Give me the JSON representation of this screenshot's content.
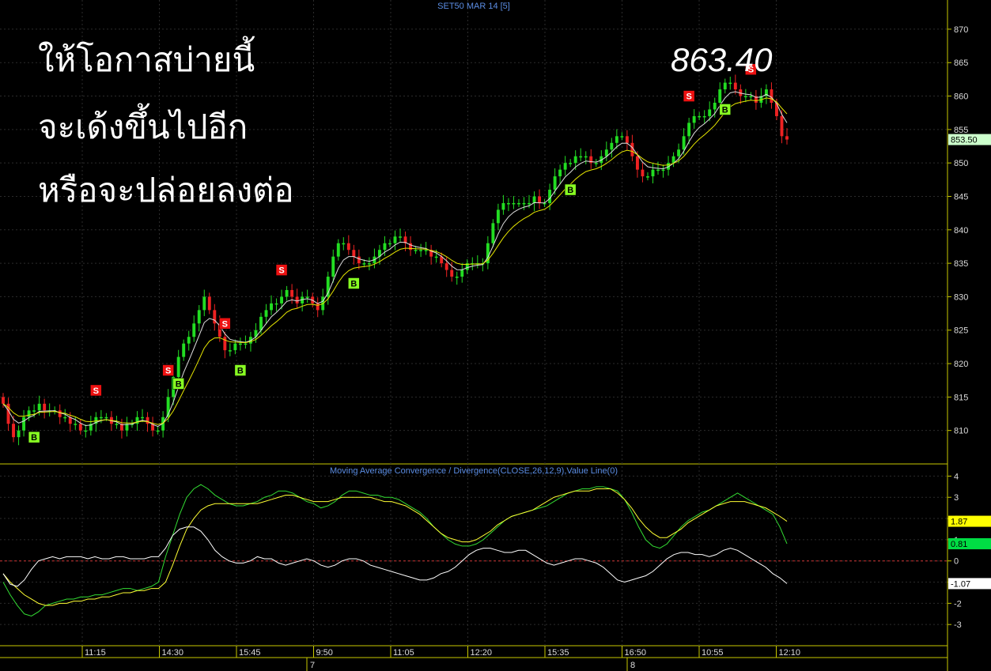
{
  "header": {
    "title": "SET50 MAR 14   [5]"
  },
  "annotations": {
    "line1": "ให้โอกาสบ่ายนี้",
    "line2": "จะเด้งขึ้นไปอีก",
    "line3": "หรือจะปล่อยลงต่อ",
    "price_note": "863.40"
  },
  "indicator": {
    "title": "Moving Average Convergence / Divergence(CLOSE,26,12,9),Value Line(0)"
  },
  "chart_data": [
    {
      "type": "candlestick",
      "title": "SET50 MAR 14   [5]",
      "ylim": [
        805,
        872
      ],
      "yticks": [
        810,
        815,
        820,
        825,
        830,
        835,
        840,
        845,
        850,
        855,
        860,
        865,
        870
      ],
      "last_price": "853.50",
      "x_tick_labels": [
        "11:15",
        "14:30",
        "15:45",
        "9:50",
        "11:05",
        "12:20",
        "15:35",
        "16:50",
        "10:55",
        "12:10"
      ],
      "day_labels": [
        "7",
        "8"
      ],
      "closes": [
        814,
        811,
        809,
        810,
        812,
        813,
        813,
        814,
        813,
        813,
        813,
        812,
        812,
        811,
        811,
        810,
        810,
        811,
        812,
        812,
        812,
        811,
        811,
        810,
        811,
        811,
        812,
        812,
        811,
        810,
        810,
        812,
        815,
        818,
        821,
        823,
        824,
        826,
        828,
        830,
        828,
        826,
        824,
        822,
        822,
        823,
        823,
        823,
        824,
        825,
        827,
        828,
        829,
        829,
        830,
        831,
        830,
        829,
        830,
        830,
        829,
        828,
        830,
        833,
        836,
        838,
        838,
        837,
        836,
        835,
        835,
        835,
        836,
        837,
        838,
        838,
        839,
        839,
        838,
        837,
        837,
        837,
        837,
        836,
        836,
        835,
        834,
        833,
        833,
        834,
        835,
        835,
        835,
        835,
        838,
        841,
        843,
        844,
        844,
        844,
        844,
        844,
        844,
        845,
        844,
        844,
        846,
        848,
        849,
        850,
        850,
        851,
        851,
        851,
        850,
        850,
        851,
        852,
        853,
        854,
        854,
        853,
        851,
        849,
        848,
        848,
        849,
        849,
        849,
        850,
        851,
        852,
        854,
        856,
        857,
        857,
        857,
        858,
        859,
        861,
        862,
        862,
        861,
        860,
        860,
        860,
        859,
        860,
        861,
        859,
        857,
        854,
        853.5
      ],
      "signals": [
        {
          "label": "B",
          "i": 6
        },
        {
          "label": "S",
          "i": 18
        },
        {
          "label": "S",
          "i": 32
        },
        {
          "label": "B",
          "i": 34
        },
        {
          "label": "S",
          "i": 43
        },
        {
          "label": "B",
          "i": 46
        },
        {
          "label": "S",
          "i": 54
        },
        {
          "label": "B",
          "i": 68
        },
        {
          "label": "B",
          "i": 110
        },
        {
          "label": "S",
          "i": 133
        },
        {
          "label": "B",
          "i": 140
        },
        {
          "label": "S",
          "i": 145
        }
      ]
    },
    {
      "type": "line",
      "title": "Moving Average Convergence / Divergence(CLOSE,26,12,9),Value Line(0)",
      "ylim": [
        -4,
        4.5
      ],
      "yticks": [
        4,
        3,
        2,
        1,
        0,
        -1,
        -2,
        -3
      ],
      "value_line": 0,
      "badges": [
        {
          "value": "1.87",
          "color": "#ffff00",
          "text_color": "#000000"
        },
        {
          "value": "0.81",
          "color": "#00dd44",
          "text_color": "#000000"
        },
        {
          "value": "-1.07",
          "color": "#ffffff",
          "text_color": "#000000"
        }
      ],
      "series": [
        {
          "color": "#33dd33",
          "values": [
            -1.0,
            -1.6,
            -2.1,
            -2.5,
            -2.6,
            -2.4,
            -2.1,
            -2.0,
            -1.9,
            -1.8,
            -1.8,
            -1.7,
            -1.7,
            -1.6,
            -1.6,
            -1.5,
            -1.4,
            -1.3,
            -1.3,
            -1.4,
            -1.3,
            -1.2,
            -1.0,
            0.2,
            1.2,
            2.2,
            3.0,
            3.4,
            3.6,
            3.4,
            3.1,
            2.9,
            2.7,
            2.6,
            2.6,
            2.7,
            2.8,
            3.0,
            3.1,
            3.3,
            3.3,
            3.2,
            3.0,
            2.8,
            2.7,
            2.5,
            2.6,
            2.8,
            3.1,
            3.3,
            3.3,
            3.2,
            3.1,
            3.1,
            3.0,
            3.0,
            2.9,
            2.7,
            2.5,
            2.3,
            2.0,
            1.6,
            1.3,
            1.0,
            0.8,
            0.7,
            0.7,
            0.8,
            1.0,
            1.3,
            1.6,
            1.9,
            2.1,
            2.2,
            2.3,
            2.4,
            2.5,
            2.6,
            2.8,
            3.0,
            3.2,
            3.3,
            3.4,
            3.4,
            3.5,
            3.5,
            3.4,
            3.3,
            2.9,
            2.3,
            1.6,
            1.0,
            0.7,
            0.6,
            0.8,
            1.2,
            1.6,
            1.9,
            2.1,
            2.3,
            2.4,
            2.6,
            2.8,
            3.0,
            3.2,
            3.0,
            2.8,
            2.6,
            2.4,
            2.2,
            1.6,
            0.81
          ]
        },
        {
          "color": "#ffff33",
          "values": [
            -0.6,
            -1.0,
            -1.3,
            -1.6,
            -1.8,
            -2.0,
            -2.1,
            -2.1,
            -2.0,
            -2.0,
            -1.9,
            -1.9,
            -1.8,
            -1.8,
            -1.7,
            -1.7,
            -1.6,
            -1.5,
            -1.5,
            -1.4,
            -1.4,
            -1.3,
            -1.3,
            -1.0,
            -0.2,
            0.7,
            1.5,
            2.0,
            2.4,
            2.6,
            2.7,
            2.7,
            2.7,
            2.7,
            2.7,
            2.7,
            2.7,
            2.8,
            2.9,
            3.0,
            3.1,
            3.1,
            3.0,
            2.9,
            2.8,
            2.8,
            2.8,
            2.9,
            3.0,
            3.0,
            3.0,
            3.0,
            3.0,
            2.9,
            2.8,
            2.8,
            2.7,
            2.6,
            2.4,
            2.2,
            1.9,
            1.6,
            1.3,
            1.1,
            1.0,
            0.9,
            0.9,
            1.0,
            1.2,
            1.4,
            1.7,
            1.9,
            2.1,
            2.2,
            2.3,
            2.4,
            2.6,
            2.8,
            3.0,
            3.1,
            3.2,
            3.3,
            3.3,
            3.3,
            3.4,
            3.4,
            3.4,
            3.2,
            2.9,
            2.5,
            2.0,
            1.6,
            1.3,
            1.1,
            1.1,
            1.3,
            1.5,
            1.8,
            2.0,
            2.2,
            2.4,
            2.6,
            2.7,
            2.8,
            2.8,
            2.8,
            2.7,
            2.6,
            2.5,
            2.3,
            2.1,
            1.87
          ]
        },
        {
          "color": "#ffffff",
          "values": [
            -0.6,
            -1.1,
            -1.2,
            -0.9,
            -0.4,
            0.0,
            0.1,
            0.2,
            0.1,
            0.2,
            0.2,
            0.2,
            0.1,
            0.2,
            0.1,
            0.1,
            0.2,
            0.2,
            0.1,
            0.1,
            0.1,
            0.2,
            0.2,
            0.6,
            1.2,
            1.5,
            1.6,
            1.6,
            1.4,
            1.0,
            0.5,
            0.2,
            0.0,
            -0.1,
            -0.1,
            0.0,
            0.2,
            0.1,
            0.1,
            -0.1,
            -0.2,
            -0.1,
            0.0,
            0.1,
            0.0,
            -0.2,
            -0.3,
            -0.2,
            0.0,
            0.1,
            0.1,
            0.0,
            -0.2,
            -0.3,
            -0.4,
            -0.5,
            -0.6,
            -0.7,
            -0.8,
            -0.9,
            -0.9,
            -0.8,
            -0.6,
            -0.5,
            -0.3,
            0.0,
            0.3,
            0.5,
            0.6,
            0.6,
            0.5,
            0.4,
            0.4,
            0.5,
            0.5,
            0.3,
            0.1,
            -0.1,
            -0.2,
            -0.1,
            0.0,
            0.1,
            0.1,
            0.0,
            -0.1,
            -0.3,
            -0.6,
            -0.9,
            -1.0,
            -0.9,
            -0.8,
            -0.7,
            -0.5,
            -0.2,
            0.1,
            0.3,
            0.4,
            0.4,
            0.3,
            0.3,
            0.2,
            0.3,
            0.5,
            0.6,
            0.5,
            0.3,
            0.1,
            -0.1,
            -0.3,
            -0.6,
            -0.8,
            -1.07
          ]
        }
      ]
    }
  ]
}
